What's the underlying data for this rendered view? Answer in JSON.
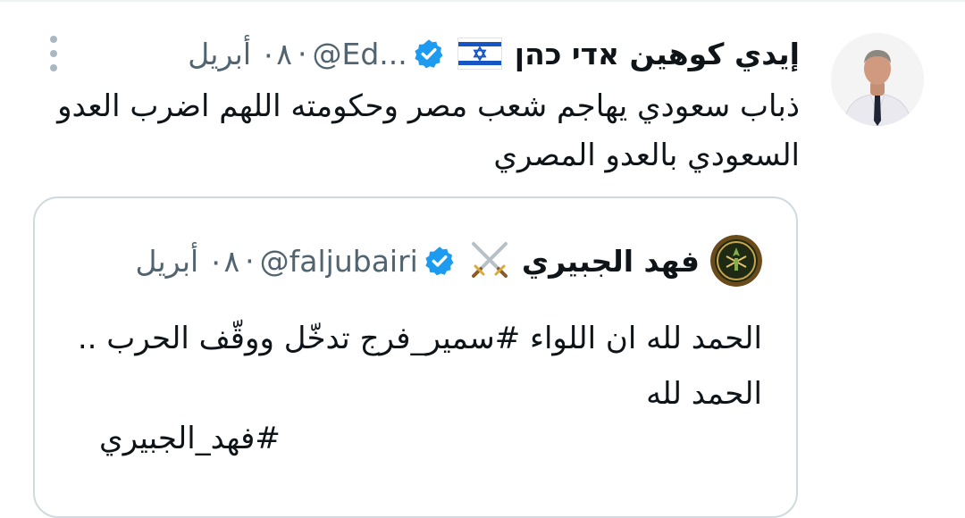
{
  "tweet": {
    "display_name": "إيدي كوهين אדי כהן",
    "handle": "@Ed...",
    "separator": "·",
    "date": "٠٨ أبريل",
    "text": "ذباب سعودي يهاجم شعب مصر وحكومته اللهم اضرب العدو السعودي بالعدو المصري",
    "flag_icon": "israel-flag-icon",
    "verified_icon": "verified-badge-icon",
    "verified_color": "#1d9bf0"
  },
  "quoted": {
    "display_name": "فهد الجبيري",
    "handle": "@faljubairi",
    "separator": "·",
    "date": "٠٨ أبريل",
    "text": "الحمد لله ان اللواء #سمير_فرج تدخّل ووقّف الحرب .. الحمد لله",
    "hashtag_line": "#فهد_الجبيري",
    "emoji_icon": "crossed-swords-icon"
  },
  "colors": {
    "text": "#0f1419",
    "secondary": "#536471",
    "border": "#cfd9de",
    "accent": "#1d9bf0"
  }
}
